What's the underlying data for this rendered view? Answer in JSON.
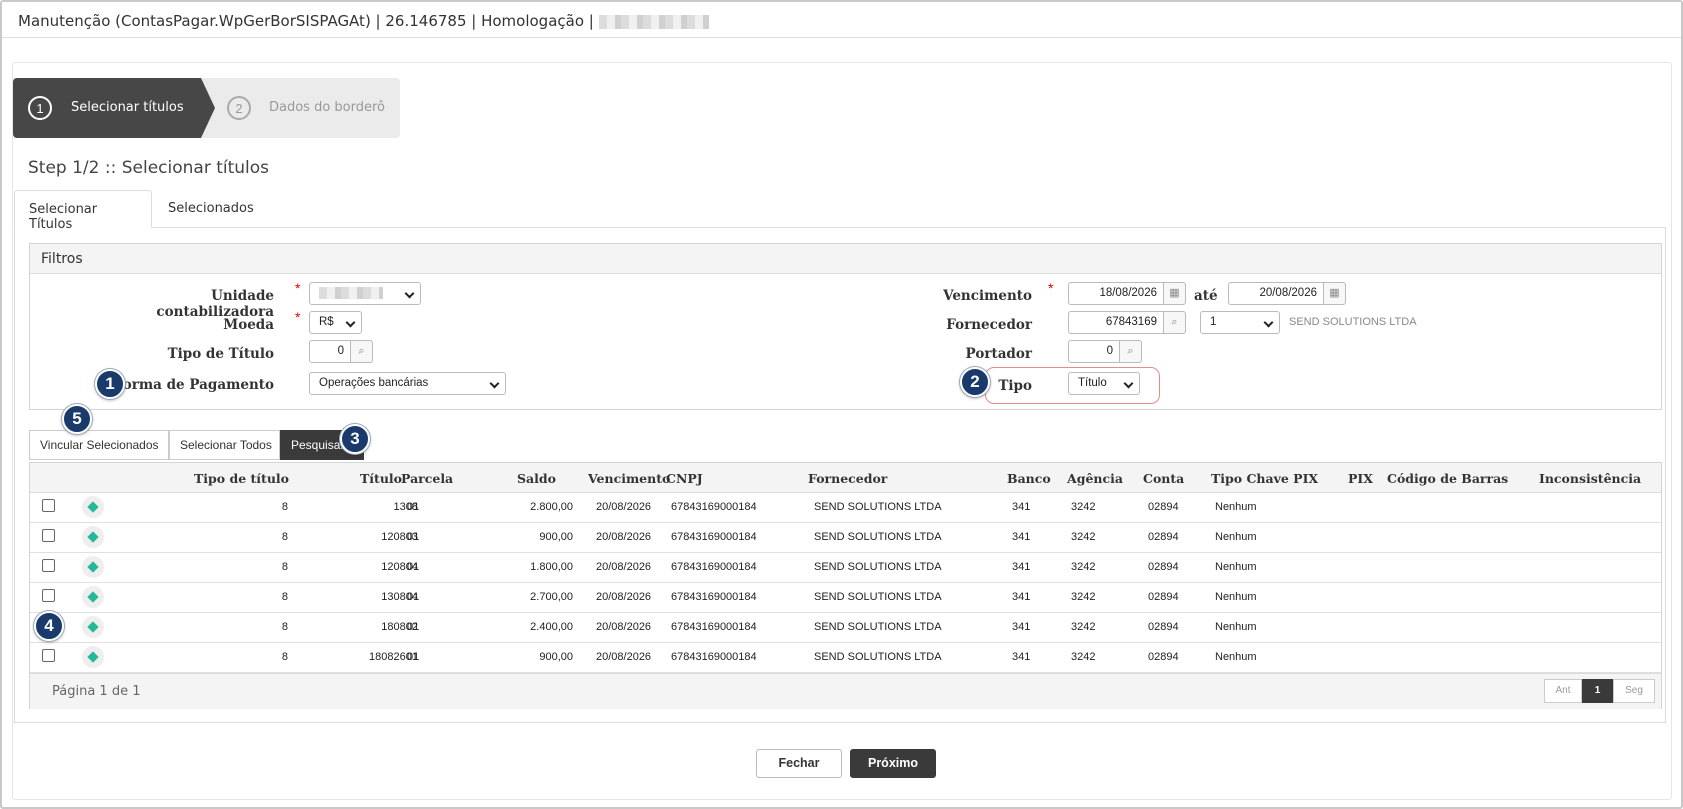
{
  "window": {
    "title": "Manutenção (ContasPagar.WpGerBorSISPAGAt) | 26.146785 | Homologação |"
  },
  "wizard": {
    "steps": [
      {
        "num": "1",
        "label": "Selecionar títulos"
      },
      {
        "num": "2",
        "label": "Dados do borderô"
      }
    ]
  },
  "step_title": "Step 1/2 :: Selecionar títulos",
  "tabs": [
    "Selecionar Títulos",
    "Selecionados"
  ],
  "filters": {
    "heading": "Filtros",
    "unidade_label": "Unidade contabilizadora",
    "moeda_label": "Moeda",
    "moeda_value": "R$",
    "tipo_titulo_label": "Tipo de Título",
    "tipo_titulo_value": "0",
    "forma_pagamento_label": "Forma de Pagamento",
    "forma_pagamento_value": "Operações bancárias",
    "vencimento_label": "Vencimento",
    "vencimento_from": "18/08/2026",
    "ate_label": "até",
    "vencimento_to": "20/08/2026",
    "fornecedor_label": "Fornecedor",
    "fornecedor_value": "67843169",
    "fornecedor_loja": "1",
    "fornecedor_name": "SEND SOLUTIONS LTDA",
    "portador_label": "Portador",
    "portador_value": "0",
    "tipo_label": "Tipo",
    "tipo_value": "Título",
    "required_mark": "*"
  },
  "badges": [
    "1",
    "2",
    "3",
    "4",
    "5"
  ],
  "actions": {
    "vincular": "Vincular Selecionados",
    "selecionar_todos": "Selecionar Todos",
    "pesquisar": "Pesquisar"
  },
  "table": {
    "headers": [
      "Tipo de título",
      "Título",
      "Parcela",
      "Saldo",
      "Vencimento",
      "CNPJ",
      "Fornecedor",
      "Banco",
      "Agência",
      "Conta",
      "Tipo Chave PIX",
      "PIX",
      "Código de Barras",
      "Inconsistência"
    ],
    "rows": [
      {
        "tipo": "8",
        "titulo": "1308",
        "parcela": "01",
        "saldo": "2.800,00",
        "vencimento": "20/08/2026",
        "cnpj": "67843169000184",
        "fornecedor": "SEND SOLUTIONS LTDA",
        "banco": "341",
        "agencia": "3242",
        "conta": "02894",
        "chave": "Nenhum"
      },
      {
        "tipo": "8",
        "titulo": "120803",
        "parcela": "01",
        "saldo": "900,00",
        "vencimento": "20/08/2026",
        "cnpj": "67843169000184",
        "fornecedor": "SEND SOLUTIONS LTDA",
        "banco": "341",
        "agencia": "3242",
        "conta": "02894",
        "chave": "Nenhum"
      },
      {
        "tipo": "8",
        "titulo": "120804",
        "parcela": "01",
        "saldo": "1.800,00",
        "vencimento": "20/08/2026",
        "cnpj": "67843169000184",
        "fornecedor": "SEND SOLUTIONS LTDA",
        "banco": "341",
        "agencia": "3242",
        "conta": "02894",
        "chave": "Nenhum"
      },
      {
        "tipo": "8",
        "titulo": "130804",
        "parcela": "01",
        "saldo": "2.700,00",
        "vencimento": "20/08/2026",
        "cnpj": "67843169000184",
        "fornecedor": "SEND SOLUTIONS LTDA",
        "banco": "341",
        "agencia": "3242",
        "conta": "02894",
        "chave": "Nenhum"
      },
      {
        "tipo": "8",
        "titulo": "180802",
        "parcela": "01",
        "saldo": "2.400,00",
        "vencimento": "20/08/2026",
        "cnpj": "67843169000184",
        "fornecedor": "SEND SOLUTIONS LTDA",
        "banco": "341",
        "agencia": "3242",
        "conta": "02894",
        "chave": "Nenhum"
      },
      {
        "tipo": "8",
        "titulo": "18082601",
        "parcela": "01",
        "saldo": "900,00",
        "vencimento": "20/08/2026",
        "cnpj": "67843169000184",
        "fornecedor": "SEND SOLUTIONS LTDA",
        "banco": "341",
        "agencia": "3242",
        "conta": "02894",
        "chave": "Nenhum"
      }
    ]
  },
  "pager": {
    "text": "Página 1 de 1",
    "prev": "Ant",
    "current": "1",
    "next": "Seg"
  },
  "footer": {
    "fechar": "Fechar",
    "proximo": "Próximo"
  },
  "icons": {
    "search": "search-icon",
    "calendar": "calendar-icon",
    "row_action": "diamond-icon"
  },
  "colors": {
    "badge": "#1a3a6b",
    "highlight": "#e98a8a",
    "active_step": "#474747",
    "row_icon": "#26b89b"
  }
}
